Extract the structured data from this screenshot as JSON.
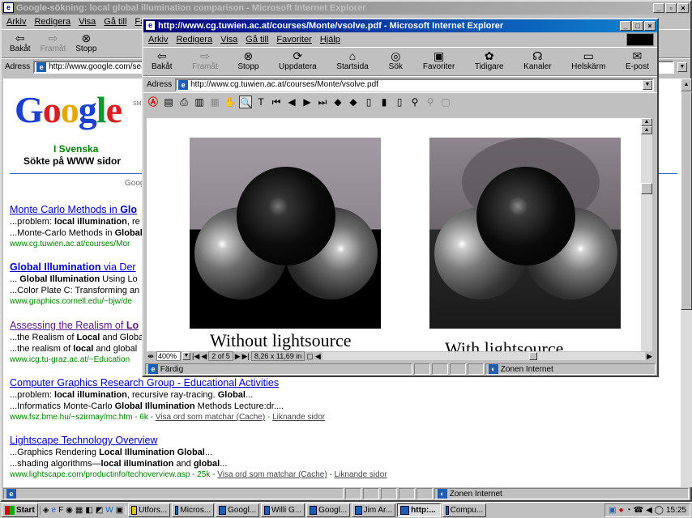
{
  "back_window": {
    "title": "Google-sökning: local global illumination comparison - Microsoft Internet Explorer",
    "menu": [
      "Arkiv",
      "Redigera",
      "Visa",
      "Gå till",
      "Fa"
    ],
    "toolbar": {
      "back": "Bakåt",
      "forward": "Framåt",
      "stop": "Stopp"
    },
    "address_label": "Adress",
    "address": "http://www.google.com/sear",
    "google_logo": "Google",
    "sm": "SM",
    "lang": "I Svenska",
    "searched": "Sökte på WWW sidor",
    "goog_frag": "Goog",
    "results": [
      {
        "title_a": "Monte Carlo Methods in ",
        "title_b": "Glo",
        "s1_a": "...problem: ",
        "s1_b": "local illumination",
        "s1_c": ", re",
        "s2_a": "...Monte-Carlo Methods in ",
        "s2_b": "Global",
        "url": "www.cg.tuwien.ac.at/courses/Mor"
      },
      {
        "title_a": "Global Illumination",
        "title_b": " via Der",
        "s1_a": "... ",
        "s1_b": "Global Illumination",
        "s1_c": " Using Lo",
        "s2_a": "...Color Plate C: Transforming an ",
        "s2_b": "i",
        "url": "www.graphics.cornell.edu/~bjw/de"
      },
      {
        "title_a": "Assessing the Realism of ",
        "title_b": "Lo",
        "s1_a": "...the Realism of ",
        "s1_b": "Local",
        "s1_c": " and Globa",
        "s2_a": "...the realism of ",
        "s2_b": "local",
        "s2_c": " and global",
        "url": "www.icg.tu-graz.ac.at/~Education"
      },
      {
        "title_a": "Computer Graphics Research Group - Educational Activities",
        "s1_a": "...problem: ",
        "s1_b": "local illumination",
        "s1_c": ", recursive ray-tracing. ",
        "s1_d": "Global",
        "s1_e": "...",
        "s2_a": "...Informatics Monte-Carlo ",
        "s2_b": "Global Illumination",
        "s2_c": " Methods Lecture:dr....",
        "url": "www.fsz.bme.hu/~szirmay/mc.htm - 6k - ",
        "cache": "Visa ord som matchar (Cache)",
        "sep": " - ",
        "similar": "Liknande sidor"
      },
      {
        "title_a": "Lightscape Technology Overview",
        "s1_a": "...Graphics Rendering ",
        "s1_b": "Local Illumination Global",
        "s1_c": "...",
        "s2_a": "...shading algorithms—",
        "s2_b": "local illumination",
        "s2_c": " and ",
        "s2_d": "global",
        "s2_e": "...",
        "url": "www.lightscape.com/productinfo/techoverview.asp - 25k - ",
        "cache": "Visa ord som matchar (Cache)",
        "sep": " - ",
        "similar": "Liknande sidor"
      }
    ],
    "status_zone": "Zonen Internet"
  },
  "front_window": {
    "title": "http://www.cg.tuwien.ac.at/courses/Monte/vsolve.pdf - Microsoft Internet Explorer",
    "menu": [
      "Arkiv",
      "Redigera",
      "Visa",
      "Gå till",
      "Favoriter",
      "Hjälp"
    ],
    "toolbar": [
      "Bakåt",
      "Framåt",
      "Stopp",
      "Uppdatera",
      "Startsida",
      "Sök",
      "Favoriter",
      "Tidigare",
      "Kanaler",
      "Helskärm",
      "E-post"
    ],
    "address_label": "Adress",
    "address": "http://www.cg.tuwien.ac.at/courses/Monte/vsolve.pdf",
    "pdf": {
      "caption_left": "Without lightsource",
      "caption_right": "With lightsource",
      "zoom": "400%",
      "page": "2 of 5",
      "size": "8,26 x 11,69 in"
    },
    "status_left": "Färdig",
    "status_zone": "Zonen Internet"
  },
  "taskbar": {
    "start": "Start",
    "buttons": [
      "Utfors...",
      "Micros...",
      "Googl...",
      "Willi G...",
      "Googl...",
      "Jim Ar...",
      "http:...",
      "Compu..."
    ],
    "clock": "15:25"
  },
  "colors": {
    "title_active": "#000080",
    "desktop": "#008080",
    "link": "#0000cc",
    "url_green": "#008000"
  }
}
